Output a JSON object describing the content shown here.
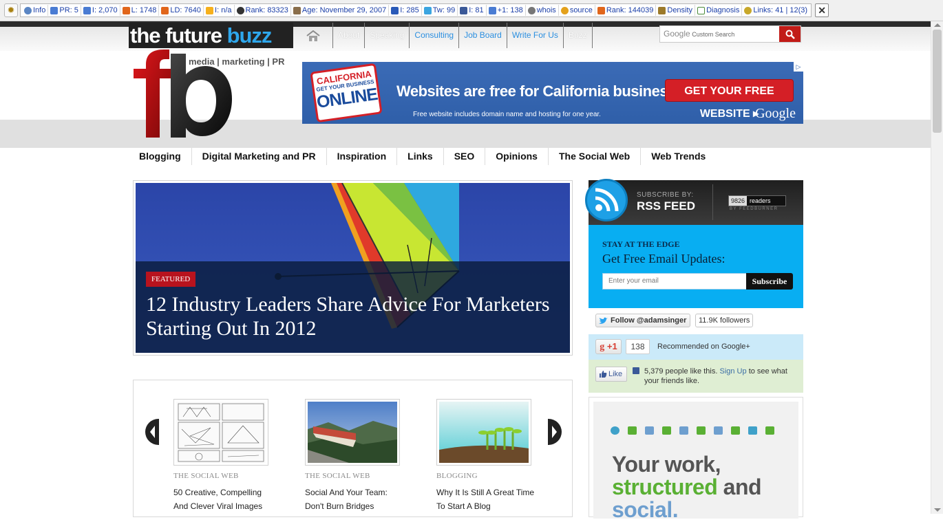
{
  "seo_toolbar": {
    "items": [
      {
        "label": "Info",
        "value": ""
      },
      {
        "label": "PR:",
        "value": "5"
      },
      {
        "label": "I:",
        "value": "2,070"
      },
      {
        "label": "L:",
        "value": "1748"
      },
      {
        "label": "LD:",
        "value": "7640"
      },
      {
        "label": "I:",
        "value": "n/a"
      },
      {
        "label": "Rank:",
        "value": "83323"
      },
      {
        "label": "Age:",
        "value": "November 29, 2007"
      },
      {
        "label": "I:",
        "value": "285"
      },
      {
        "label": "Tw:",
        "value": "99"
      },
      {
        "label": "I:",
        "value": "81"
      },
      {
        "label": "+1:",
        "value": "138"
      },
      {
        "label": "whois",
        "value": ""
      },
      {
        "label": "source",
        "value": ""
      },
      {
        "label": "Rank:",
        "value": "144039"
      },
      {
        "label": "Density",
        "value": ""
      },
      {
        "label": "Diagnosis",
        "value": ""
      },
      {
        "label": "Links:",
        "value": "41 | 12(3)"
      }
    ]
  },
  "header": {
    "brand_part1": "the future ",
    "brand_part2": "buzz",
    "logo_text": "fb",
    "tagline": "media | marketing | PR"
  },
  "main_nav": {
    "items": [
      "About",
      "Speaking",
      "Consulting",
      "Job Board",
      "Write For Us",
      "Buzz"
    ]
  },
  "search": {
    "brand": "Google",
    "placeholder": "Custom Search"
  },
  "banner_ad": {
    "badge_line1": "CALIFORNIA",
    "badge_line2": "GET YOUR BUSINESS",
    "badge_line3": "ONLINE",
    "headline": "Websites are free for California businesses.",
    "subline": "Free website includes domain name and hosting for one year.",
    "cta": "GET YOUR FREE WEBSITE ▸",
    "brand": "Google"
  },
  "category_nav": {
    "items": [
      "Blogging",
      "Digital Marketing and PR",
      "Inspiration",
      "Links",
      "SEO",
      "Opinions",
      "The Social Web",
      "Web Trends"
    ]
  },
  "featured": {
    "badge": "FEATURED",
    "title": "12 Industry Leaders Share Advice For Marketers Starting Out In 2012"
  },
  "posts": [
    {
      "category": "THE SOCIAL WEB",
      "title": "50 Creative, Compelling And Clever Viral Images"
    },
    {
      "category": "THE SOCIAL WEB",
      "title": "Social And Your Team: Don't Burn Bridges"
    },
    {
      "category": "BLOGGING",
      "title": "Why It Is Still A Great Time To Start A Blog"
    }
  ],
  "sidebar": {
    "rss": {
      "subscribe_by": "SUBSCRIBE BY:",
      "rss_feed": "RSS FEED",
      "readers_count": "9826",
      "readers_label": "readers",
      "by_feedburner": "BY FEEDBURNER"
    },
    "email": {
      "kicker": "STAY AT THE EDGE",
      "title": "Get Free Email Updates:",
      "placeholder": "Enter your email",
      "button": "Subscribe"
    },
    "twitter": {
      "follow": "Follow @adamsinger",
      "followers": "11.9K followers"
    },
    "gplus": {
      "button": "+1",
      "count": "138",
      "text": "Recommended on Google+"
    },
    "facebook": {
      "like": "Like",
      "text_before": "5,379 people like this.",
      "signup": "Sign Up",
      "text_after": "to see what your friends like."
    },
    "promo": {
      "line1": "Your work,",
      "line2a": "structured",
      "line2b": " and",
      "line3": "social."
    }
  }
}
